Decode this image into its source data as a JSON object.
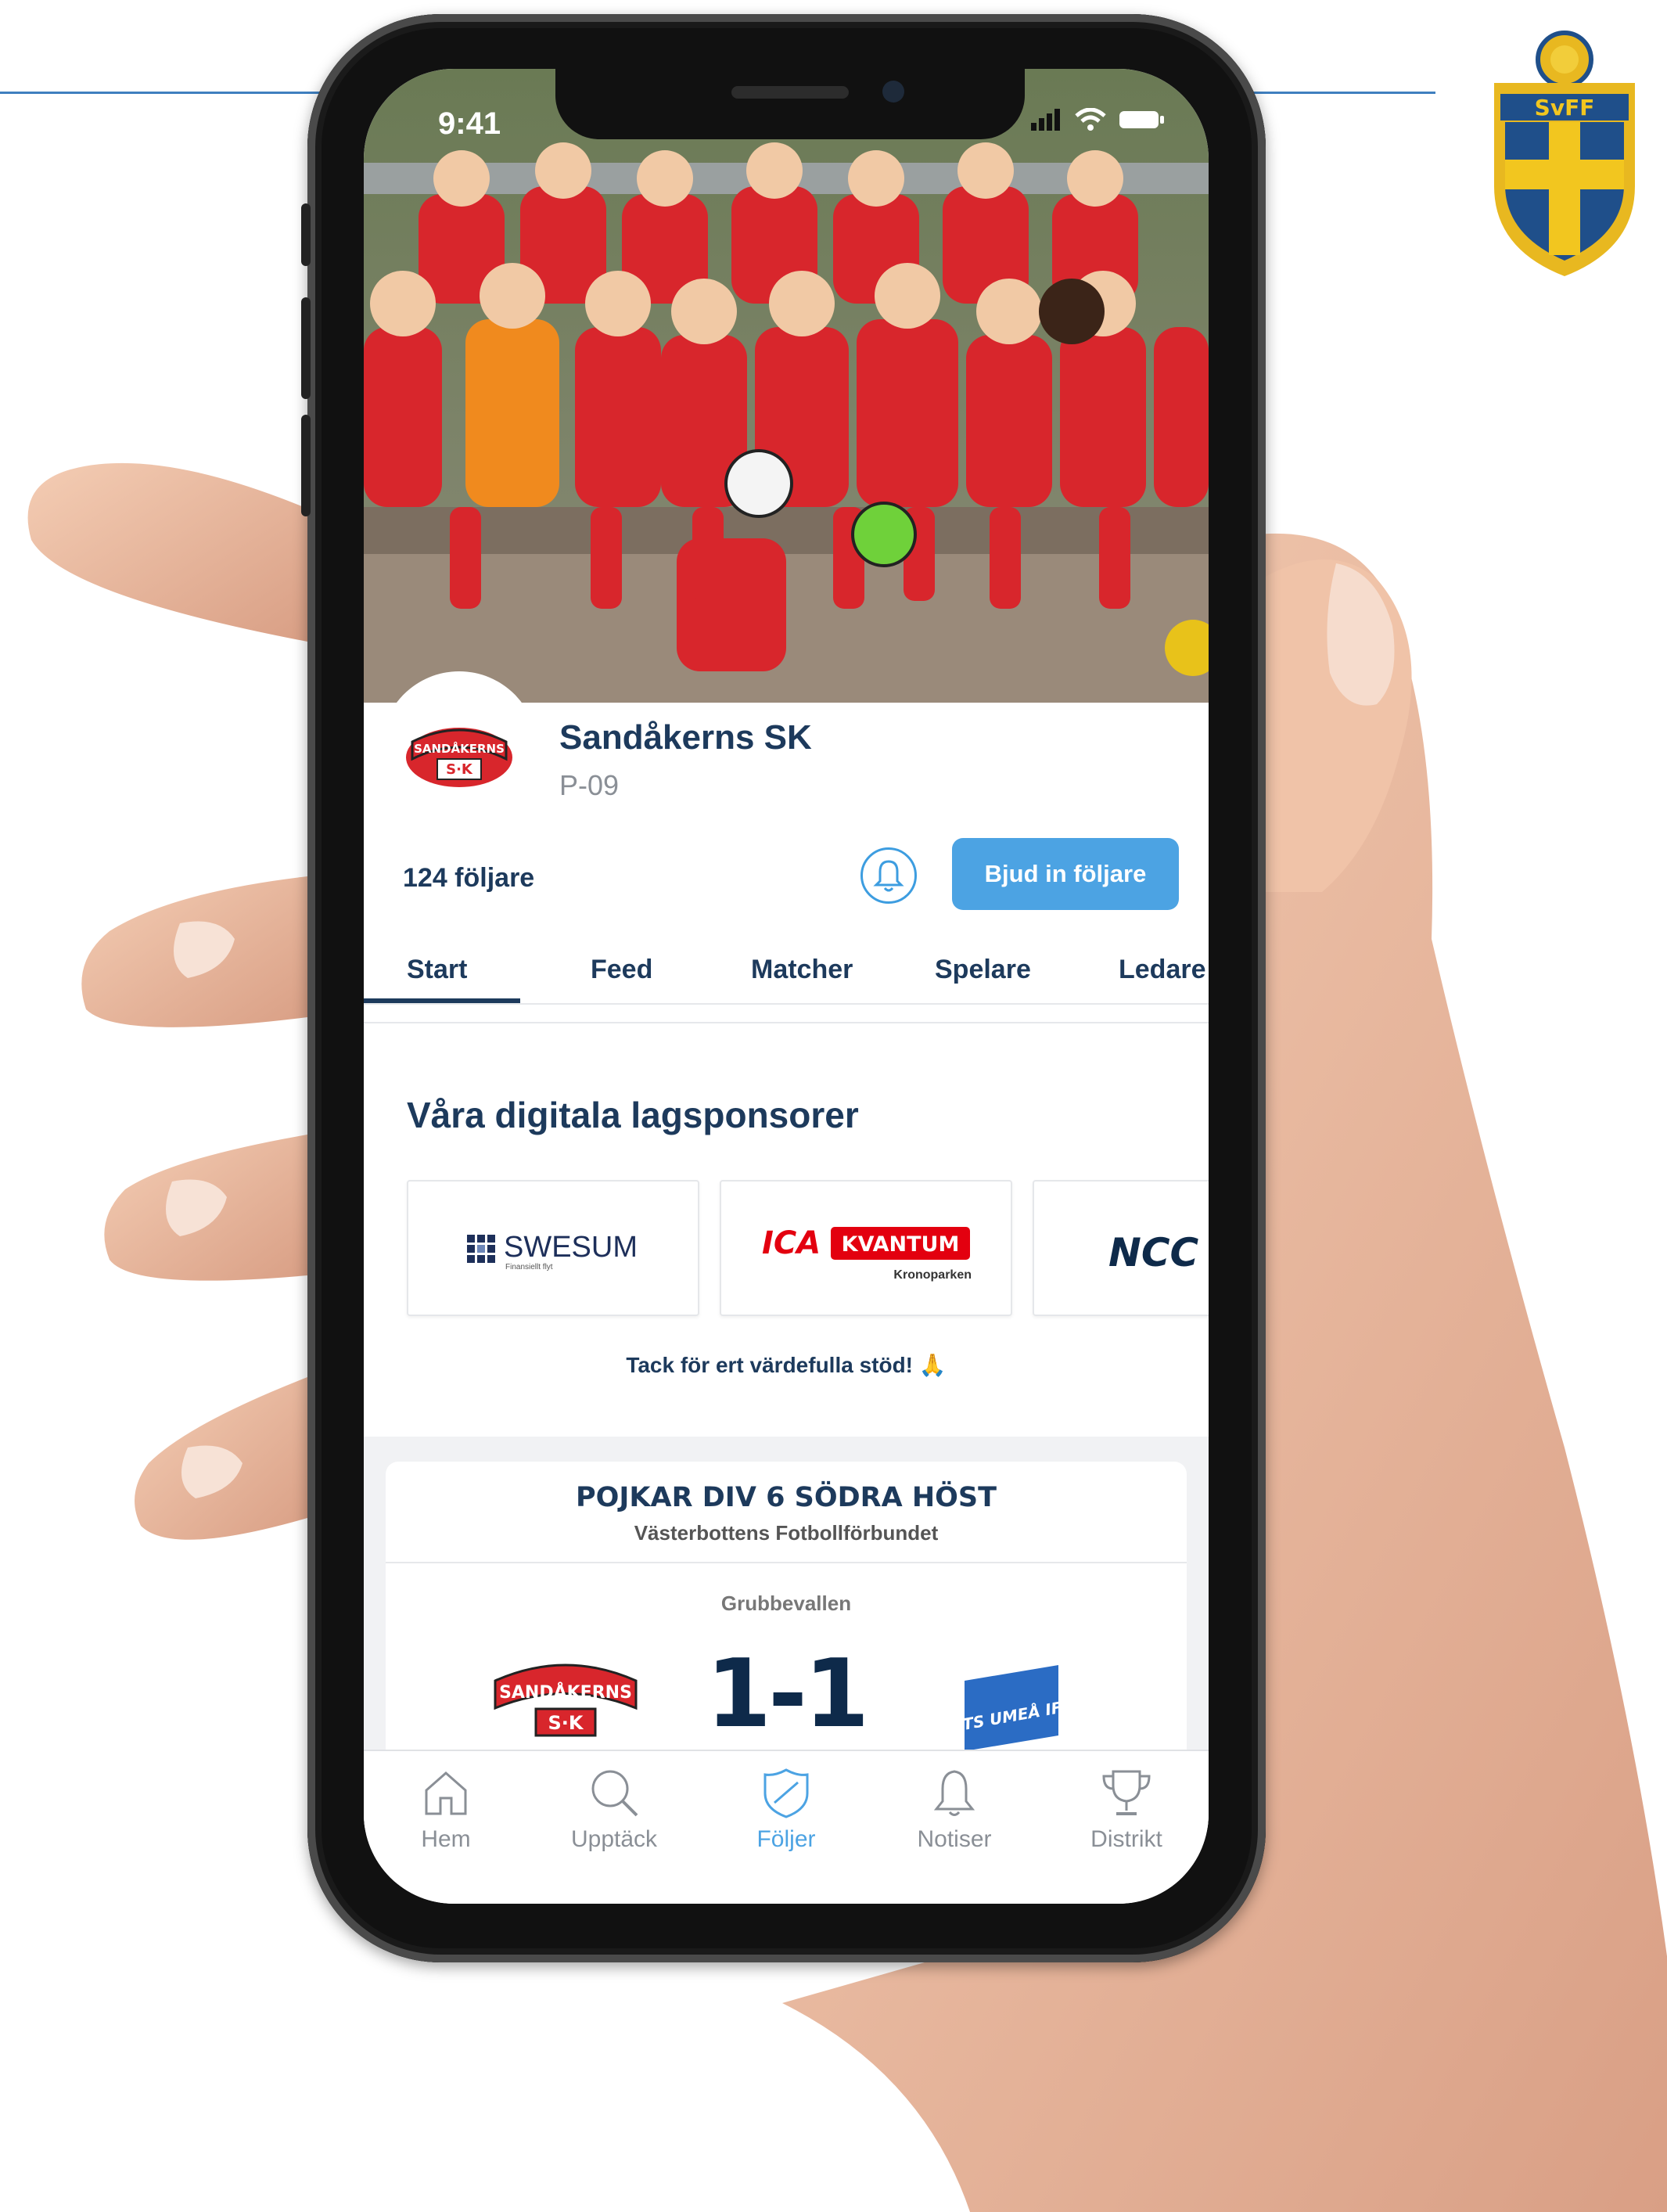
{
  "status_bar": {
    "time": "9:41"
  },
  "club": {
    "name": "Sandåkerns SK",
    "team": "P-09",
    "followers": "124 följare",
    "invite_label": "Bjud in följare",
    "logo_text_top": "SANDÅKERNS",
    "logo_text_bottom": "S·K"
  },
  "tabs": [
    {
      "label": "Start",
      "active": true
    },
    {
      "label": "Feed"
    },
    {
      "label": "Matcher"
    },
    {
      "label": "Spelare"
    },
    {
      "label": "Ledare"
    }
  ],
  "sponsors": {
    "title": "Våra digitala lagsponsorer",
    "items": [
      {
        "name": "SWESUM",
        "tagline": "Finansiellt flyt"
      },
      {
        "name_part1": "ICA",
        "name_part2": "KVANTUM",
        "tagline": "Kronoparken"
      },
      {
        "name": "NCC"
      }
    ],
    "thanks": "Tack för ert värdefulla stöd! 🙏"
  },
  "match": {
    "league": "POJKAR DIV 6 SÖDRA HÖST",
    "association": "Västerbottens Fotbollförbundet",
    "venue": "Grubbevallen",
    "score": "1-1",
    "away_logo_text": "TS UMEÅ IF"
  },
  "bottom_nav": [
    {
      "label": "Hem",
      "icon": "home-icon"
    },
    {
      "label": "Upptäck",
      "icon": "search-icon"
    },
    {
      "label": "Följer",
      "icon": "shield-icon",
      "active": true
    },
    {
      "label": "Notiser",
      "icon": "bell-icon"
    },
    {
      "label": "Distrikt",
      "icon": "trophy-icon"
    }
  ],
  "badge": {
    "text": "SvFF"
  },
  "colors": {
    "primary": "#1d3a5c",
    "accent": "#4ca3e3",
    "club_red": "#d8262c"
  }
}
